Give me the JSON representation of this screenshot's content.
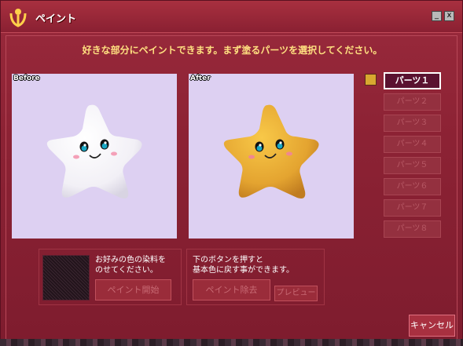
{
  "window": {
    "title": "ペイント",
    "minimize_label": "_",
    "close_label": "x"
  },
  "instruction": "好きな部分にペイントできます。まず塗るパーツを選択してください。",
  "preview": {
    "before_label": "Before",
    "after_label": "After",
    "before_color": "#ffffff",
    "after_color": "#e8ac30"
  },
  "selected_color": "#d8a830",
  "parts": [
    {
      "label": "パーツ１",
      "active": true
    },
    {
      "label": "パーツ２",
      "active": false
    },
    {
      "label": "パーツ３",
      "active": false
    },
    {
      "label": "パーツ４",
      "active": false
    },
    {
      "label": "パーツ５",
      "active": false
    },
    {
      "label": "パーツ６",
      "active": false
    },
    {
      "label": "パーツ７",
      "active": false
    },
    {
      "label": "パーツ８",
      "active": false
    }
  ],
  "paint_box": {
    "text_line1": "お好みの色の染料を",
    "text_line2": "のせてください。",
    "start_button": "ペイント開始"
  },
  "remove_box": {
    "text_line1": "下のボタンを押すと",
    "text_line2": "基本色に戻す事ができます。",
    "remove_button": "ペイント除去",
    "preview_button": "プレビュー"
  },
  "cancel_button": "キャンセル"
}
